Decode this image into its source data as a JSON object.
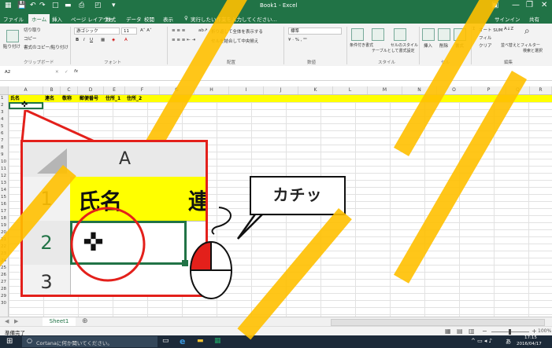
{
  "window": {
    "title": "Book1 - Excel",
    "user": "サインイン",
    "share": "共有"
  },
  "tabs": [
    "ファイル",
    "ホーム",
    "挿入",
    "ページ レイアウト",
    "数式",
    "データ",
    "校閲",
    "表示"
  ],
  "tell_me": "実行したい作業を入力してください...",
  "ribbon": {
    "cut": "切り取り",
    "copy": "コピー",
    "paste": "貼り付け",
    "format_painter": "書式のコピー/貼り付け",
    "clipboard_label": "クリップボード",
    "font_name": "游ゴシック",
    "font_size": "11",
    "font_label": "フォント",
    "wrap_text": "折り返して全体を表示する",
    "merge_center": "セルを結合して中央揃え",
    "alignment_label": "配置",
    "number_format": "標準",
    "number_label": "数値",
    "conditional_format": "条件付き書式",
    "format_as_table": "テーブルとして書式設定",
    "cell_styles": "セルのスタイル",
    "styles_label": "スタイル",
    "insert": "挿入",
    "delete": "削除",
    "format": "書式",
    "cells_label": "セル",
    "autosum": "オート SUM",
    "fill": "フィル",
    "clear": "クリア",
    "sort_filter": "並べ替えとフィルター",
    "find_select": "検索と選択",
    "editing_label": "編集"
  },
  "formula_bar": {
    "name_box": "A2",
    "fx": "fx",
    "value": ""
  },
  "columns": [
    "A",
    "B",
    "C",
    "D",
    "E",
    "F",
    "G",
    "H",
    "I",
    "J",
    "K",
    "L",
    "M",
    "N",
    "O",
    "P",
    "Q",
    "R",
    "S"
  ],
  "rows": [
    "1",
    "2",
    "3",
    "4",
    "5",
    "6",
    "7",
    "8",
    "9",
    "10",
    "11",
    "12",
    "13",
    "14",
    "15",
    "16",
    "17",
    "18",
    "19",
    "20",
    "21",
    "22",
    "23",
    "24",
    "25",
    "26",
    "27",
    "28",
    "29",
    "30"
  ],
  "row1_headers": [
    "氏名",
    "連名",
    "敬称",
    "郵便番号",
    "住所_1",
    "住所_2"
  ],
  "sheet_tab": "Sheet1",
  "add_sheet": "⊕",
  "status": "準備完了",
  "zoom_level": "100%",
  "taskbar": {
    "cortana": "Cortanaに何か聞いてください。",
    "time": "17:15",
    "date": "2016/04/17",
    "ime": "あ"
  },
  "callout": {
    "col_letter": "A",
    "row1": "1",
    "row2": "2",
    "row3": "3",
    "cell_text": "氏名",
    "cell_partial": "連",
    "sound": "カチッ"
  },
  "colors": {
    "excel_green": "#217346",
    "highlight_yellow": "#ffff00",
    "stripe_orange": "#ffc000",
    "callout_red": "#e3201b"
  }
}
